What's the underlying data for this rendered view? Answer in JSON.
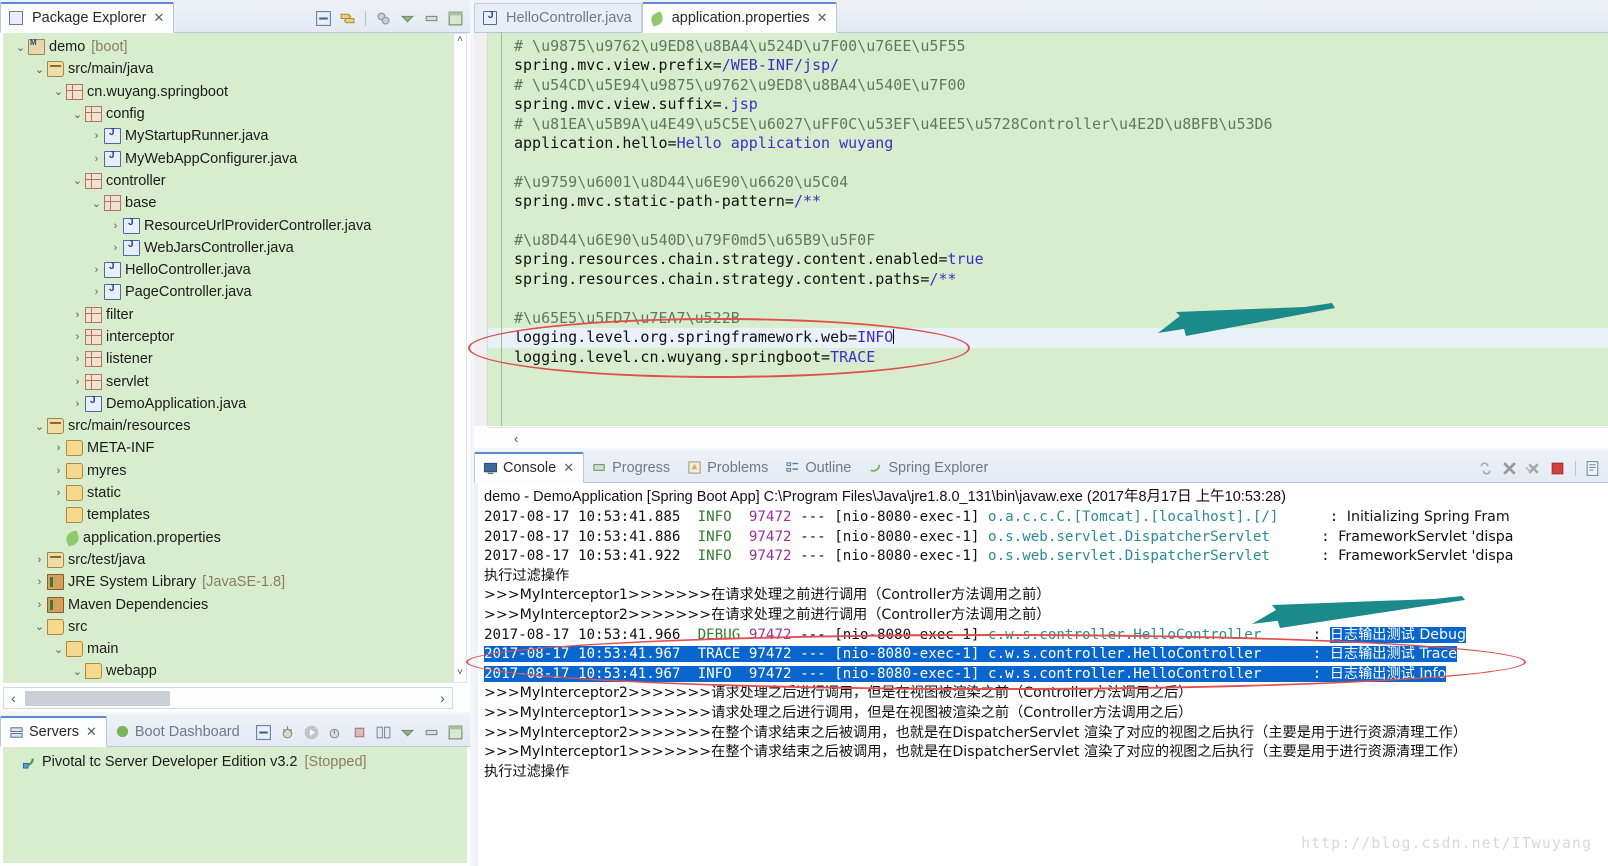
{
  "package_explorer": {
    "tab_label": "Package Explorer",
    "close_glyph": "✕",
    "toolbar_icons": [
      "collapse-all-icon",
      "link-with-editor-icon",
      "focus-on-active-task-icon",
      "view-menu-icon",
      "minimize-icon",
      "maximize-icon"
    ],
    "tree": [
      {
        "indent": 0,
        "arrow": "v",
        "icon": "project-icon",
        "label": "demo",
        "suffix": "[boot]"
      },
      {
        "indent": 1,
        "arrow": "v",
        "icon": "source-folder-icon",
        "label": "src/main/java",
        "suffix": ""
      },
      {
        "indent": 2,
        "arrow": "v",
        "icon": "package-icon",
        "label": "cn.wuyang.springboot",
        "suffix": ""
      },
      {
        "indent": 3,
        "arrow": "v",
        "icon": "package-icon",
        "label": "config",
        "suffix": ""
      },
      {
        "indent": 4,
        "arrow": ">",
        "icon": "java-file-icon",
        "label": "MyStartupRunner.java",
        "suffix": ""
      },
      {
        "indent": 4,
        "arrow": ">",
        "icon": "java-file-icon",
        "label": "MyWebAppConfigurer.java",
        "suffix": ""
      },
      {
        "indent": 3,
        "arrow": "v",
        "icon": "package-icon",
        "label": "controller",
        "suffix": ""
      },
      {
        "indent": 4,
        "arrow": "v",
        "icon": "package-icon",
        "label": "base",
        "suffix": ""
      },
      {
        "indent": 5,
        "arrow": ">",
        "icon": "java-file-icon",
        "label": "ResourceUrlProviderController.java",
        "suffix": ""
      },
      {
        "indent": 5,
        "arrow": ">",
        "icon": "java-file-icon",
        "label": "WebJarsController.java",
        "suffix": ""
      },
      {
        "indent": 4,
        "arrow": ">",
        "icon": "java-file-icon",
        "label": "HelloController.java",
        "suffix": ""
      },
      {
        "indent": 4,
        "arrow": ">",
        "icon": "java-file-icon",
        "label": "PageController.java",
        "suffix": ""
      },
      {
        "indent": 3,
        "arrow": ">",
        "icon": "package-icon",
        "label": "filter",
        "suffix": ""
      },
      {
        "indent": 3,
        "arrow": ">",
        "icon": "package-icon",
        "label": "interceptor",
        "suffix": ""
      },
      {
        "indent": 3,
        "arrow": ">",
        "icon": "package-icon",
        "label": "listener",
        "suffix": ""
      },
      {
        "indent": 3,
        "arrow": ">",
        "icon": "package-icon",
        "label": "servlet",
        "suffix": ""
      },
      {
        "indent": 3,
        "arrow": ">",
        "icon": "java-file-icon",
        "label": "DemoApplication.java",
        "suffix": ""
      },
      {
        "indent": 1,
        "arrow": "v",
        "icon": "source-folder-icon",
        "label": "src/main/resources",
        "suffix": ""
      },
      {
        "indent": 2,
        "arrow": ">",
        "icon": "folder-icon",
        "label": "META-INF",
        "suffix": ""
      },
      {
        "indent": 2,
        "arrow": ">",
        "icon": "folder-icon",
        "label": "myres",
        "suffix": ""
      },
      {
        "indent": 2,
        "arrow": ">",
        "icon": "folder-icon",
        "label": "static",
        "suffix": ""
      },
      {
        "indent": 2,
        "arrow": "",
        "icon": "folder-icon",
        "label": "templates",
        "suffix": ""
      },
      {
        "indent": 2,
        "arrow": "",
        "icon": "properties-file-icon",
        "label": "application.properties",
        "suffix": ""
      },
      {
        "indent": 1,
        "arrow": ">",
        "icon": "source-folder-icon",
        "label": "src/test/java",
        "suffix": ""
      },
      {
        "indent": 1,
        "arrow": ">",
        "icon": "library-icon",
        "label": "JRE System Library",
        "suffix": "[JavaSE-1.8]"
      },
      {
        "indent": 1,
        "arrow": ">",
        "icon": "library-icon",
        "label": "Maven Dependencies",
        "suffix": ""
      },
      {
        "indent": 1,
        "arrow": "v",
        "icon": "folder-icon",
        "label": "src",
        "suffix": ""
      },
      {
        "indent": 2,
        "arrow": "v",
        "icon": "folder-icon",
        "label": "main",
        "suffix": ""
      },
      {
        "indent": 3,
        "arrow": "v",
        "icon": "folder-icon",
        "label": "webapp",
        "suffix": ""
      }
    ]
  },
  "servers_view": {
    "tabs": [
      {
        "label": "Servers",
        "active": true,
        "icon": "servers-icon"
      },
      {
        "label": "Boot Dashboard",
        "active": false,
        "icon": "boot-dashboard-icon"
      }
    ],
    "close_glyph": "✕",
    "toolbar_icons": [
      "collapse-all-icon",
      "debug-icon",
      "start-icon",
      "profile-icon",
      "stop-icon",
      "publish-icon",
      "view-menu-icon",
      "minimize-icon",
      "maximize-icon"
    ],
    "rows": [
      {
        "icon": "server-icon",
        "label": "Pivotal tc Server Developer Edition v3.2",
        "status": "[Stopped]"
      }
    ]
  },
  "editor": {
    "tabs": [
      {
        "label": "HelloController.java",
        "active": false,
        "icon": "java-file-icon"
      },
      {
        "label": "application.properties",
        "active": true,
        "icon": "properties-file-icon"
      }
    ],
    "close_glyph": "✕",
    "lines": [
      {
        "type": "comment",
        "text": "# \\u9875\\u9762\\u9ED8\\u8BA4\\u524D\\u7F00\\u76EE\\u5F55"
      },
      {
        "type": "kv",
        "key": "spring.mvc.view.prefix=",
        "value": "/WEB-INF/jsp/"
      },
      {
        "type": "comment",
        "text": "# \\u54CD\\u5E94\\u9875\\u9762\\u9ED8\\u8BA4\\u540E\\u7F00"
      },
      {
        "type": "kv",
        "key": "spring.mvc.view.suffix=",
        "value": ".jsp"
      },
      {
        "type": "comment",
        "text": "# \\u81EA\\u5B9A\\u4E49\\u5C5E\\u6027\\uFF0C\\u53EF\\u4EE5\\u5728Controller\\u4E2D\\u8BFB\\u53D6"
      },
      {
        "type": "kv",
        "key": "application.hello=",
        "value": "Hello application wuyang"
      },
      {
        "type": "blank",
        "text": ""
      },
      {
        "type": "comment",
        "text": "#\\u9759\\u6001\\u8D44\\u6E90\\u6620\\u5C04"
      },
      {
        "type": "kv",
        "key": "spring.mvc.static-path-pattern=",
        "value": "/**"
      },
      {
        "type": "blank",
        "text": ""
      },
      {
        "type": "comment",
        "text": "#\\u8D44\\u6E90\\u540D\\u79F0md5\\u65B9\\u5F0F"
      },
      {
        "type": "kv",
        "key": "spring.resources.chain.strategy.content.enabled=",
        "value": "true"
      },
      {
        "type": "kv",
        "key": "spring.resources.chain.strategy.content.paths=",
        "value": "/**"
      },
      {
        "type": "blank",
        "text": ""
      },
      {
        "type": "comment",
        "text": "#\\u65E5\\u5FD7\\u7EA7\\u522B"
      },
      {
        "type": "kv_current",
        "key": "logging.level.org.springframework.web=",
        "value": "INFO"
      },
      {
        "type": "kv",
        "key": "logging.level.cn.wuyang.springboot=",
        "value": "TRACE"
      }
    ]
  },
  "console": {
    "tabs": [
      {
        "label": "Console",
        "active": true,
        "icon": "console-icon"
      },
      {
        "label": "Progress",
        "active": false,
        "icon": "progress-icon"
      },
      {
        "label": "Problems",
        "active": false,
        "icon": "problems-icon"
      },
      {
        "label": "Outline",
        "active": false,
        "icon": "outline-icon"
      },
      {
        "label": "Spring Explorer",
        "active": false,
        "icon": "spring-explorer-icon"
      }
    ],
    "close_glyph": "✕",
    "toolbar_icons": [
      "scroll-lock-icon",
      "clear-console-icon",
      "remove-all-terminated-icon",
      "terminate-icon",
      "open-console-icon"
    ],
    "launch_config": "demo - DemoApplication [Spring Boot App] C:\\Program Files\\Java\\jre1.8.0_131\\bin\\javaw.exe (2017年8月17日 上午10:53:28)",
    "lines": [
      {
        "style": "log",
        "selected": false,
        "time": "2017-08-17 10:53:41.885",
        "level": "INFO ",
        "pid": "97472",
        "thread": "[nio-8080-exec-1]",
        "logger": "o.a.c.c.C.[Tomcat].[localhost].[/]",
        "pad": "      ",
        "msg": "Initializing Spring Fram"
      },
      {
        "style": "log",
        "selected": false,
        "time": "2017-08-17 10:53:41.886",
        "level": "INFO ",
        "pid": "97472",
        "thread": "[nio-8080-exec-1]",
        "logger": "o.s.web.servlet.DispatcherServlet",
        "pad": "      ",
        "msg": "FrameworkServlet 'dispa"
      },
      {
        "style": "log",
        "selected": false,
        "time": "2017-08-17 10:53:41.922",
        "level": "INFO ",
        "pid": "97472",
        "thread": "[nio-8080-exec-1]",
        "logger": "o.s.web.servlet.DispatcherServlet",
        "pad": "      ",
        "msg": "FrameworkServlet 'dispa"
      },
      {
        "style": "plain",
        "selected": false,
        "text": "执行过滤操作"
      },
      {
        "style": "plain",
        "selected": false,
        "text": ">>>MyInterceptor1>>>>>>>在请求处理之前进行调用（Controller方法调用之前）"
      },
      {
        "style": "plain",
        "selected": false,
        "text": ">>>MyInterceptor2>>>>>>>在请求处理之前进行调用（Controller方法调用之前）"
      },
      {
        "style": "log",
        "selected": false,
        "time": "2017-08-17 10:53:41.966",
        "level": "DEBUG",
        "pid": "97472",
        "thread": "[nio-8080-exec-1]",
        "logger": "c.w.s.controller.HelloController",
        "pad": "      ",
        "msg": "日志输出测试 Debug",
        "msg_selected": true
      },
      {
        "style": "log",
        "selected": true,
        "time": "2017-08-17 10:53:41.967",
        "level": "TRACE",
        "pid": "97472",
        "thread": "[nio-8080-exec-1]",
        "logger": "c.w.s.controller.HelloController",
        "pad": "      ",
        "msg": "日志输出测试 Trace"
      },
      {
        "style": "log",
        "selected": true,
        "time": "2017-08-17 10:53:41.967",
        "level": "INFO ",
        "pid": "97472",
        "thread": "[nio-8080-exec-1]",
        "logger": "c.w.s.controller.HelloController",
        "pad": "      ",
        "msg": "日志输出测试 Info"
      },
      {
        "style": "plain",
        "selected": false,
        "text": ">>>MyInterceptor2>>>>>>>请求处理之后进行调用，但是在视图被渲染之前（Controller方法调用之后）"
      },
      {
        "style": "plain",
        "selected": false,
        "text": ">>>MyInterceptor1>>>>>>>请求处理之后进行调用，但是在视图被渲染之前（Controller方法调用之后）"
      },
      {
        "style": "plain",
        "selected": false,
        "text": ">>>MyInterceptor2>>>>>>>在整个请求结束之后被调用，也就是在DispatcherServlet 渲染了对应的视图之后执行（主要是用于进行资源清理工作）"
      },
      {
        "style": "plain",
        "selected": false,
        "text": ">>>MyInterceptor1>>>>>>>在整个请求结束之后被调用，也就是在DispatcherServlet 渲染了对应的视图之后执行（主要是用于进行资源清理工作）"
      },
      {
        "style": "plain",
        "selected": false,
        "text": "执行过滤操作"
      }
    ]
  },
  "annotations": {
    "watermark": "http://blog.csdn.net/ITwuyang",
    "ellipse_color": "#e05050",
    "arrow_color": "#1b8a8a"
  }
}
